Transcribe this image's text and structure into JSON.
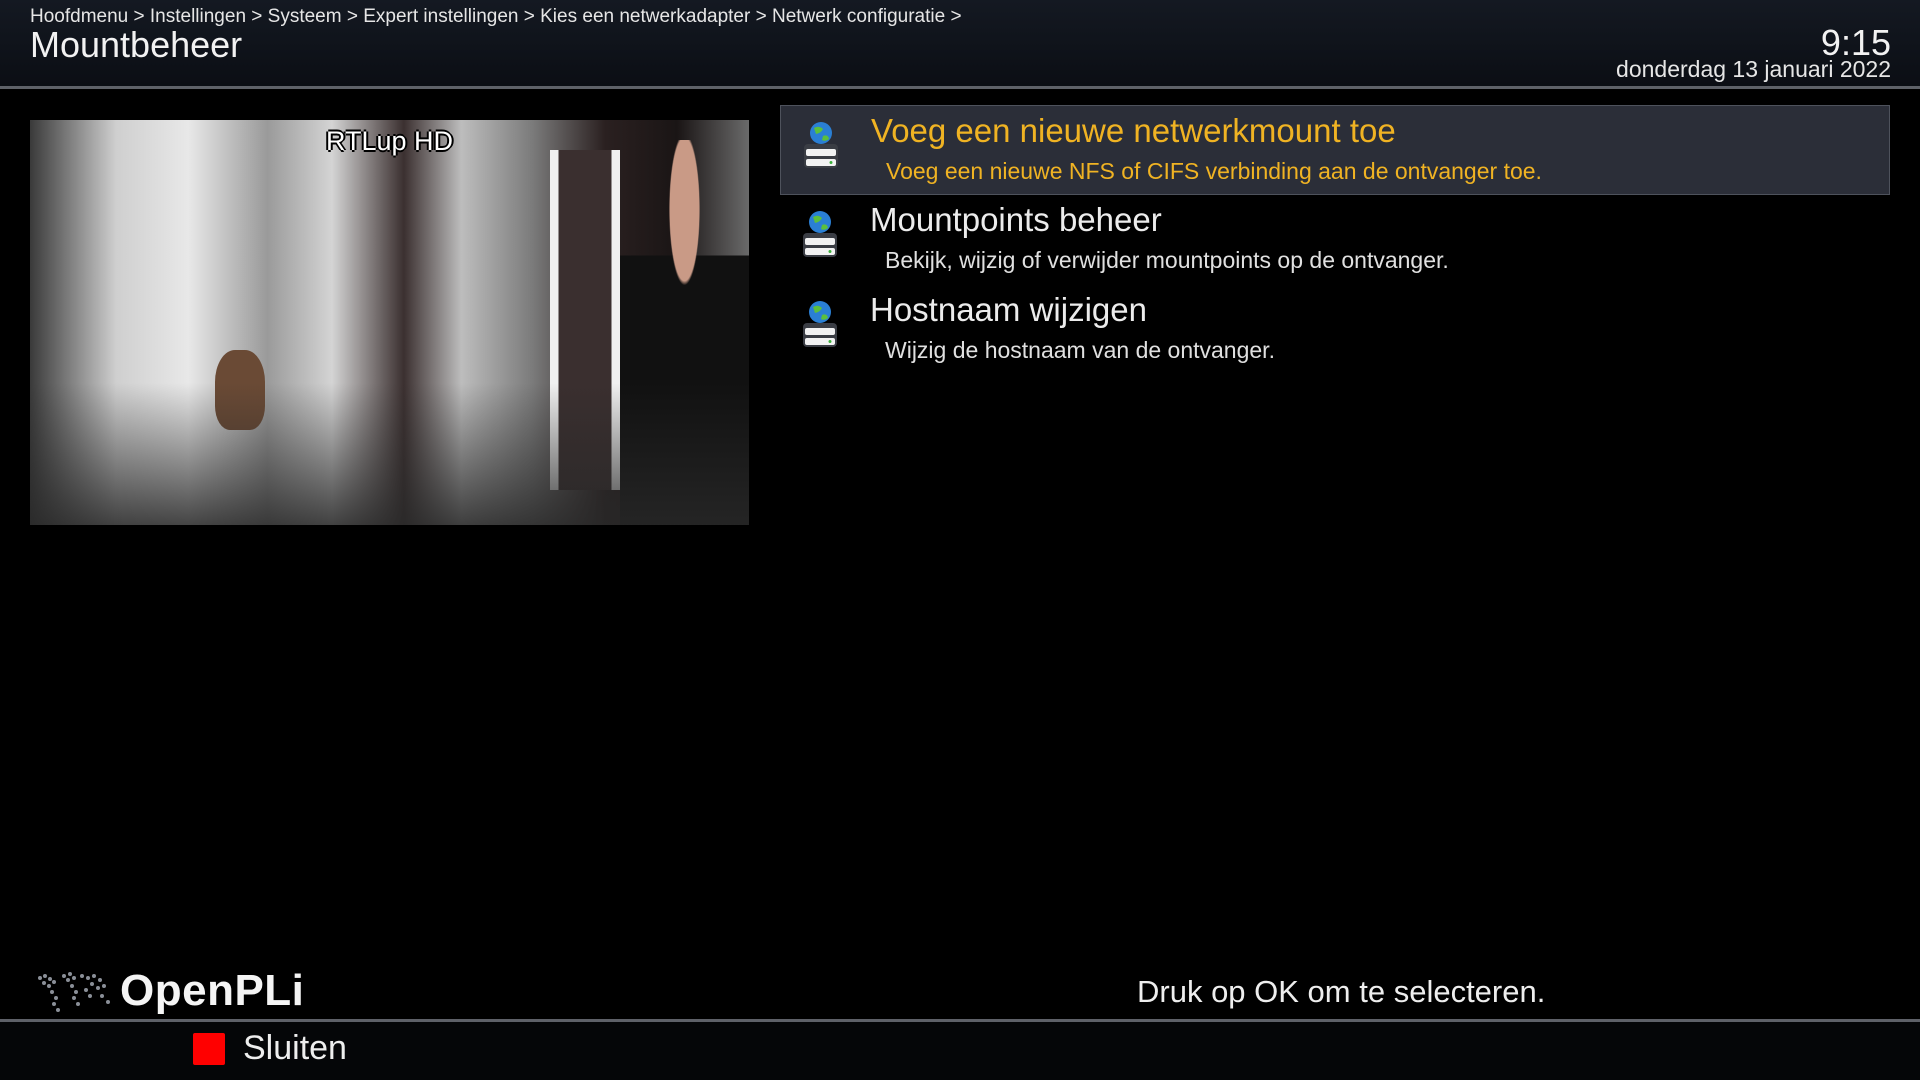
{
  "header": {
    "breadcrumb": "Hoofdmenu > Instellingen > Systeem > Expert instellingen > Kies een netwerkadapter > Netwerk configuratie >",
    "title": "Mountbeheer",
    "time": "9:15",
    "date": "donderdag 13 januari 2022"
  },
  "preview": {
    "channel_name": "RTLup HD"
  },
  "menu": {
    "items": [
      {
        "title": "Voeg een nieuwe netwerkmount toe",
        "description": "Voeg een nieuwe NFS of CIFS verbinding aan de ontvanger toe.",
        "icon": "network-drive-icon",
        "selected": true
      },
      {
        "title": "Mountpoints beheer",
        "description": "Bekijk, wijzig of verwijder mountpoints op de ontvanger.",
        "icon": "network-drive-icon",
        "selected": false
      },
      {
        "title": "Hostnaam wijzigen",
        "description": "Wijzig de hostnaam van de ontvanger.",
        "icon": "network-drive-icon",
        "selected": false
      }
    ]
  },
  "footer": {
    "logo_text": "OpenPLi",
    "hint": "Druk op OK om te selecteren.",
    "red_button_label": "Sluiten"
  },
  "colors": {
    "selected_text": "#f0b323",
    "selected_background": "#2b2e38",
    "red_key": "#ff0000"
  }
}
